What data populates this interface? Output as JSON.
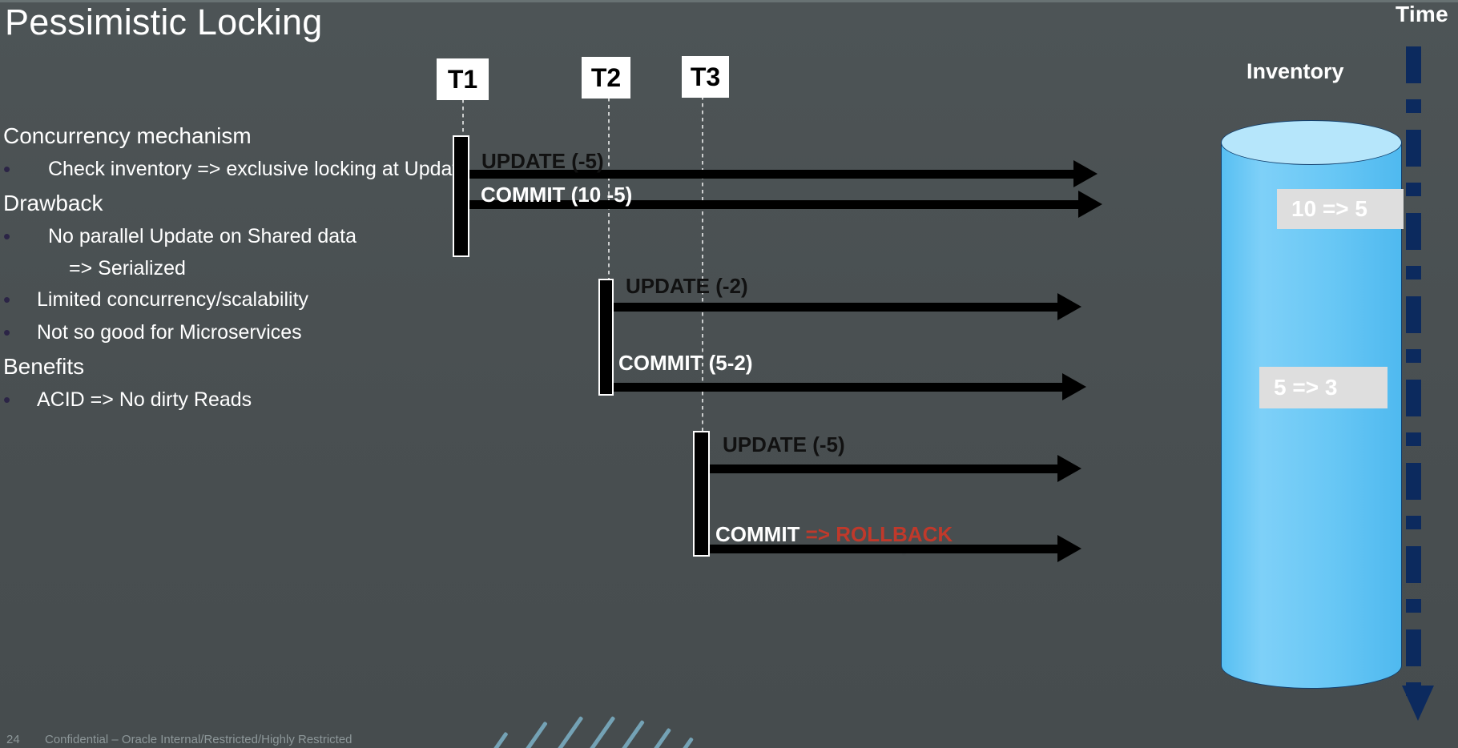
{
  "slide": {
    "title": "Pessimistic Locking",
    "background_color": "#4b5254"
  },
  "content": {
    "sections": [
      {
        "heading": "Concurrency mechanism",
        "bullets": [
          "Check inventory => exclusive locking at Update"
        ]
      },
      {
        "heading": "Drawback",
        "bullets": [
          "No parallel Update on Shared data",
          "=> Serialized",
          "Limited concurrency/scalability",
          "Not so good for Microservices"
        ]
      },
      {
        "heading": "Benefits",
        "bullets": [
          "ACID => No dirty Reads"
        ]
      }
    ],
    "lines": {
      "h1": "Concurrency mechanism",
      "b1": "Check inventory => exclusive locking at Update",
      "h2": "Drawback",
      "b2": "No parallel Update on Shared data",
      "b2sub": "=> Serialized",
      "b3": "Limited concurrency/scalability",
      "b4": "Not so good for Microservices",
      "h3": "Benefits",
      "b5": "ACID => No dirty Reads"
    }
  },
  "diagram": {
    "time_label": "Time",
    "inventory_label": "Inventory",
    "transactions": [
      {
        "id": "T1",
        "label": "T1"
      },
      {
        "id": "T2",
        "label": "T2"
      },
      {
        "id": "T3",
        "label": "T3"
      }
    ],
    "messages": [
      {
        "id": "t1-update",
        "text": "UPDATE (-5)",
        "style": "dark"
      },
      {
        "id": "t1-commit",
        "text": "COMMIT (10 -5)",
        "style": "light"
      },
      {
        "id": "t2-update",
        "text": "UPDATE (-2)",
        "style": "dark"
      },
      {
        "id": "t2-commit",
        "text": "COMMIT (5-2)",
        "style": "light"
      },
      {
        "id": "t3-update",
        "text": "UPDATE (-5)",
        "style": "dark"
      },
      {
        "id": "t3-commit",
        "text": "COMMIT ",
        "style": "light",
        "suffix": "=> ROLLBACK",
        "suffix_color": "#c0392b"
      }
    ],
    "inventory_values": [
      {
        "id": "badge-1",
        "text": "10 => 5"
      },
      {
        "id": "badge-2",
        "text": "5 => 3"
      }
    ],
    "colors": {
      "cylinder": "#68c7f5",
      "cylinder_top": "#b6e6fb",
      "time_axis": "#0c2a5e",
      "rollback": "#c0392b",
      "badge_bg": "#dedede"
    }
  },
  "footer": {
    "page_number": "24",
    "confidentiality": "Confidential – Oracle Internal/Restricted/Highly Restricted"
  }
}
